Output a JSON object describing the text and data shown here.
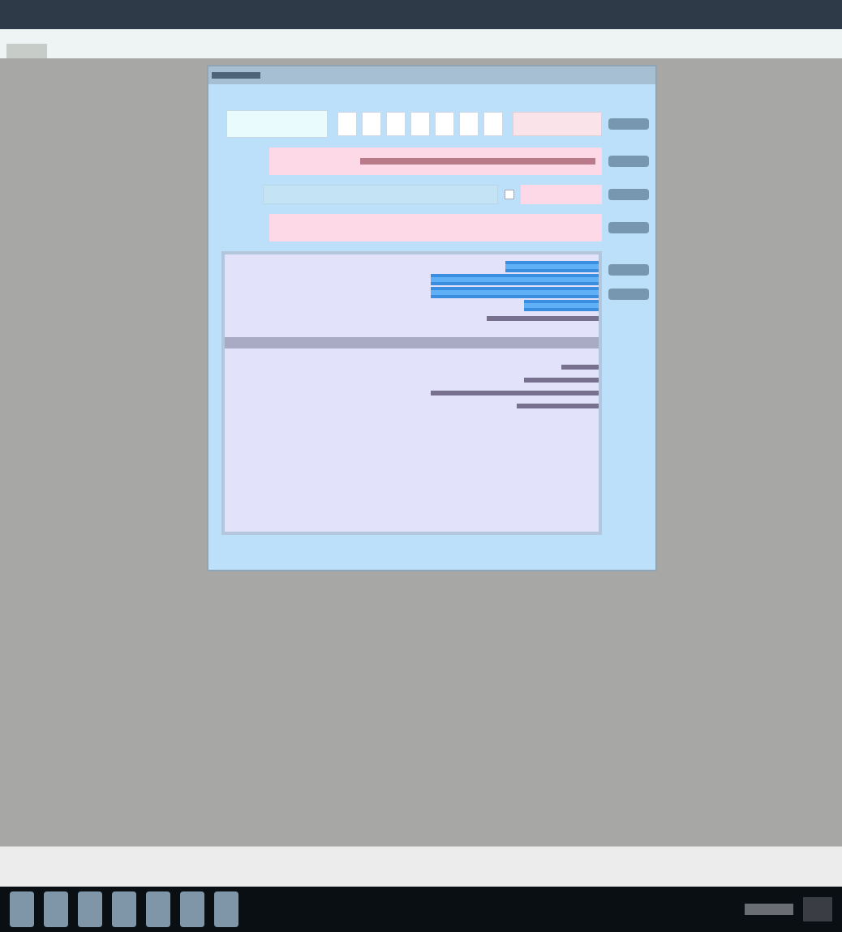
{
  "form": {
    "rows": [
      {
        "kind": "code"
      },
      {
        "kind": "wide"
      },
      {
        "kind": "split",
        "checked": false
      },
      {
        "kind": "wide"
      }
    ]
  },
  "lists": [
    {
      "items": [
        {
          "selected": true
        },
        {
          "selected": true
        },
        {
          "selected": true
        },
        {
          "selected": true
        },
        {
          "selected": false
        }
      ]
    },
    {
      "items": [
        {
          "selected": false
        },
        {
          "selected": false
        },
        {
          "selected": false
        },
        {
          "selected": false
        }
      ]
    }
  ],
  "taskbar": {
    "apps": [
      {
        "kind": "app"
      },
      {
        "kind": "app"
      },
      {
        "kind": "app"
      },
      {
        "kind": "app"
      },
      {
        "kind": "app"
      },
      {
        "kind": "app"
      },
      {
        "kind": "app"
      }
    ]
  }
}
